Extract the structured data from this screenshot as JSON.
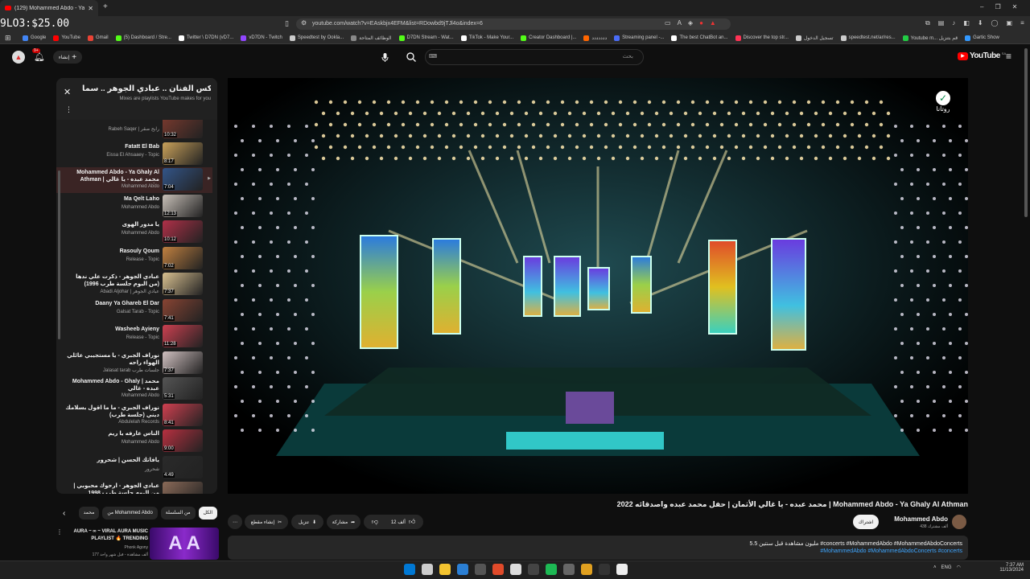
{
  "overlay_price": "9LO3:$25.00",
  "browser": {
    "tab_title": "(129) Mohammed Abdo - Ya",
    "url": "youtube.com/watch?v=EAskbjx4EFM&list=RDowbd9jTJl4o&index=6",
    "bookmarks": [
      {
        "label": "Google",
        "color": "#4285f4"
      },
      {
        "label": "YouTube",
        "color": "#ff0000"
      },
      {
        "label": "Gmail",
        "color": "#ea4335"
      },
      {
        "label": "(5) Dashboard / Stre...",
        "color": "#53fc18"
      },
      {
        "label": "Twitter \\ D7DN (vD7...",
        "color": "#ffffff"
      },
      {
        "label": "vD7DN - Twitch",
        "color": "#9146ff"
      },
      {
        "label": "Speedtest by Ookla...",
        "color": "#cccccc"
      },
      {
        "label": "الوظائف المتاحة",
        "color": "#888888"
      },
      {
        "label": "D7DN Stream - Wat...",
        "color": "#53fc18"
      },
      {
        "label": "TikTok - Make Your...",
        "color": "#ffffff"
      },
      {
        "label": "Creator Dashboard |...",
        "color": "#53fc18"
      },
      {
        "label": "ددددددد",
        "color": "#ff6600"
      },
      {
        "label": "Streaming panel -...",
        "color": "#4a6cf7"
      },
      {
        "label": "The best ChatBot an...",
        "color": "#ffffff"
      },
      {
        "label": "Discover the top str...",
        "color": "#ff3355"
      },
      {
        "label": "تسجيل الدخول",
        "color": "#cccccc"
      },
      {
        "label": "speedtest.net/ar/res...",
        "color": "#cccccc"
      },
      {
        "label": "Youtube m... قم بتنزيل",
        "color": "#22cc44"
      },
      {
        "label": "Gartic Show",
        "color": "#3399ff"
      }
    ]
  },
  "youtube": {
    "logo_text": "YouTube",
    "logo_region": "SA",
    "search_placeholder": "بحث",
    "create_label": "إنشاء",
    "notif_count": "9+"
  },
  "playlist": {
    "title": "ميكس الفنان .. عبادي الجوهر .. سما...",
    "subtitle": "Mixes are playlists YouTube makes for you",
    "items": [
      {
        "title": "",
        "channel": "Rabeh Saqer | رابح صقر",
        "duration": "10:32",
        "color": "#7a3a2e"
      },
      {
        "title": "Fatatt El Bab",
        "channel": "Eissa El Ahsaaey - Topic",
        "duration": "8:17",
        "color": "#c9a15a"
      },
      {
        "title": "Mohammed Abdo - Ya Ghaly Al Athman | محمد عبده - يا غالي الأثمان",
        "channel": "Mohammed Abdo",
        "duration": "7:04",
        "color": "#335588",
        "active": true
      },
      {
        "title": "Ma Qelt Laho",
        "channel": "Mohammed Abdo",
        "duration": "12:13",
        "color": "#c8c0b8"
      },
      {
        "title": "يا مدور الهوى",
        "channel": "Mohammed Abdo",
        "duration": "10:12",
        "color": "#b03048"
      },
      {
        "title": "Rasouly Qoum",
        "channel": "Release - Topic",
        "duration": "7:02",
        "color": "#c08040"
      },
      {
        "title": "عبادي الجوهر - ذكرت علي ندها (من البوم جلسة طرب 1996)",
        "channel": "Abadi Aljohar | عبادي الجوهر",
        "duration": "7:37",
        "color": "#d8c090"
      },
      {
        "title": "Daany Ya Ghareb El Dar",
        "channel": "Galsat Tarab - Topic",
        "duration": "7:41",
        "color": "#884433"
      },
      {
        "title": "Washeeb Ayieny",
        "channel": "Release - Topic",
        "duration": "11:28",
        "color": "#cc4050"
      },
      {
        "title": "نوراف الجبري - يا مستجيبي عائلي الهواء راحه",
        "channel": "Jalasat tarab جلسات طرب",
        "duration": "7:37",
        "color": "#d0c0c0"
      },
      {
        "title": "Mohammed Abdo - Ghaly | محمد عبده - غالي",
        "channel": "Mohammed Abdo",
        "duration": "5:31",
        "color": "#555555"
      },
      {
        "title": "نوراف الجبري - ما ما اقول بسلامك ديني (جلسة طرب)",
        "channel": "Abdulelah Records",
        "duration": "8:41",
        "color": "#d04050"
      },
      {
        "title": "الناس عارفه يا ريم",
        "channel": "Mohammed Abdo",
        "duration": "9:00",
        "color": "#b83040"
      },
      {
        "title": "يافاتك الحسن | شحرور",
        "channel": "شحرور",
        "duration": "4:49",
        "color": "#2a2a2a"
      },
      {
        "title": "عبادي الجوهر - ارحوك محبوبي | من البوم جلسة طرب 1998",
        "channel": "",
        "duration": "8:20",
        "color": "#8a6a58"
      }
    ]
  },
  "video": {
    "title": "محمد عبده - يا غالي الأثمان | حفل محمد عبده واصدقائه 2022 | Mohammed Abdo - Ya Ghaly Al Athman",
    "channel_name": "Mohammed Abdo",
    "subscribers": "438 ألف مشترك",
    "subscribe_label": "اشتراك",
    "likes": "12 ألف",
    "share_label": "مشاركة",
    "download_label": "تنزيل",
    "clip_label": "إنشاء مقطع",
    "desc_line1": "5.5 مليون مشاهدة قبل سنتين #concerts #MohammedAbdo #MohammedAbdoConcerts",
    "desc_line2": "#MohammedAbdo #MohammedAbdoConcerts #concerts",
    "logo_text": "روتانا"
  },
  "chips": [
    "الكل",
    "من السلسلة",
    "من Mohammed Abdo",
    "محمد"
  ],
  "recommendation": {
    "title": "AURA ~ ∞ ~ VIRAL AURA MUSIC PLAYLIST 🔥 TRENDING",
    "channel": "Phonk Agony",
    "meta": "177 ألف مشاهدة - قبل شهر واحد"
  },
  "taskbar": {
    "lang": "ENG",
    "time": "7:37 AM",
    "date": "11/13/2024"
  }
}
